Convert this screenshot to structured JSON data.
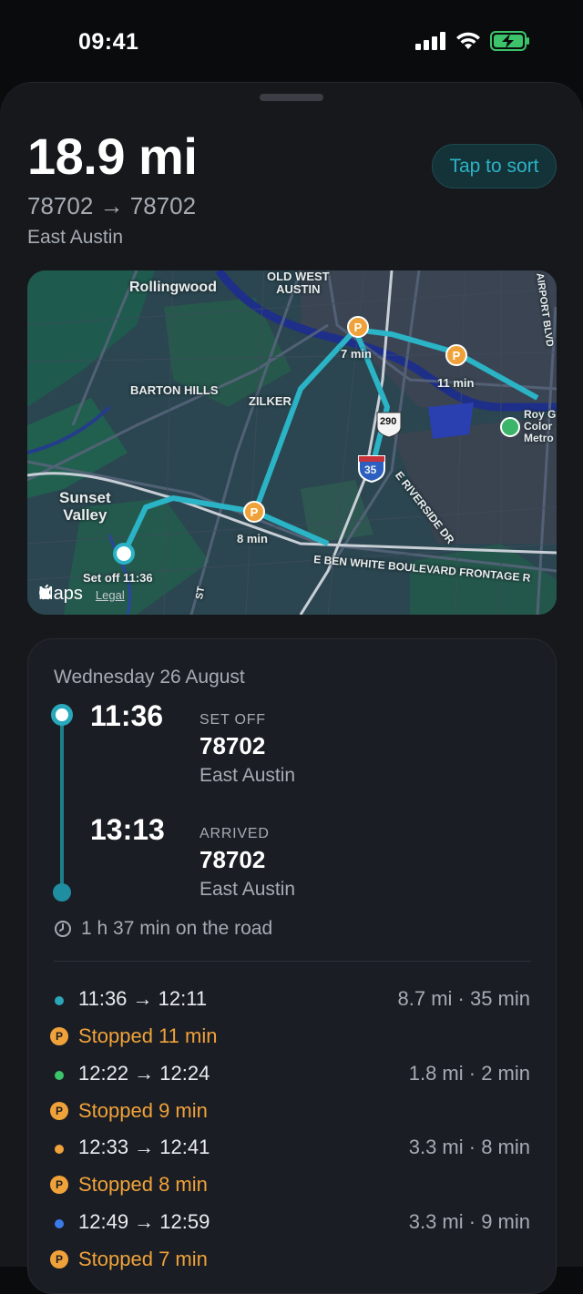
{
  "status_bar": {
    "time": "09:41"
  },
  "trip": {
    "distance": "18.9 mi",
    "route": "78702 → 78702",
    "area": "East Austin",
    "sort_button": "Tap to sort"
  },
  "map": {
    "labels": {
      "rollingwood": "Rollingwood",
      "old_west_austin": "OLD WEST\nAUSTIN",
      "barton_hills": "BARTON HILLS",
      "zilker": "ZILKER",
      "sunset_valley": "Sunset\nValley",
      "riverside": "E RIVERSIDE DR",
      "ben_white": "E BEN WHITE BOULEVARD FRONTAGE R",
      "airport": "AIRPORT BLVD",
      "roy": "Roy G\nColor\nMetro",
      "st": "ST"
    },
    "stops": [
      "7 min",
      "11 min",
      "8 min"
    ],
    "start_label": "Set off 11:36",
    "highway_290": "290",
    "highway_35": "35",
    "maps_logo": "Maps",
    "legal": "Legal",
    "route_color": "#2bb3c6",
    "stop_color": "#f0a23a"
  },
  "details": {
    "date": "Wednesday 26 August",
    "setoff": {
      "time": "11:36",
      "tag": "SET OFF",
      "zip": "78702",
      "area": "East Austin"
    },
    "arrived": {
      "time": "13:13",
      "tag": "ARRIVED",
      "zip": "78702",
      "area": "East Austin"
    },
    "duration": "1 h 37 min on the road",
    "segments": [
      {
        "times": "11:36 → 12:11",
        "stats": "8.7 mi · 35 min",
        "color": "#2ba5b8"
      },
      {
        "times": "12:22 → 12:24",
        "stats": "1.8 mi · 2 min",
        "color": "#3cc46a"
      },
      {
        "times": "12:33 → 12:41",
        "stats": "3.3 mi · 8 min",
        "color": "#f0a23a"
      },
      {
        "times": "12:49 → 12:59",
        "stats": "3.3 mi · 9 min",
        "color": "#3a7bea"
      }
    ],
    "stops": [
      "Stopped 11 min",
      "Stopped 9 min",
      "Stopped 8 min",
      "Stopped 7 min"
    ],
    "stop_icon": "P"
  }
}
